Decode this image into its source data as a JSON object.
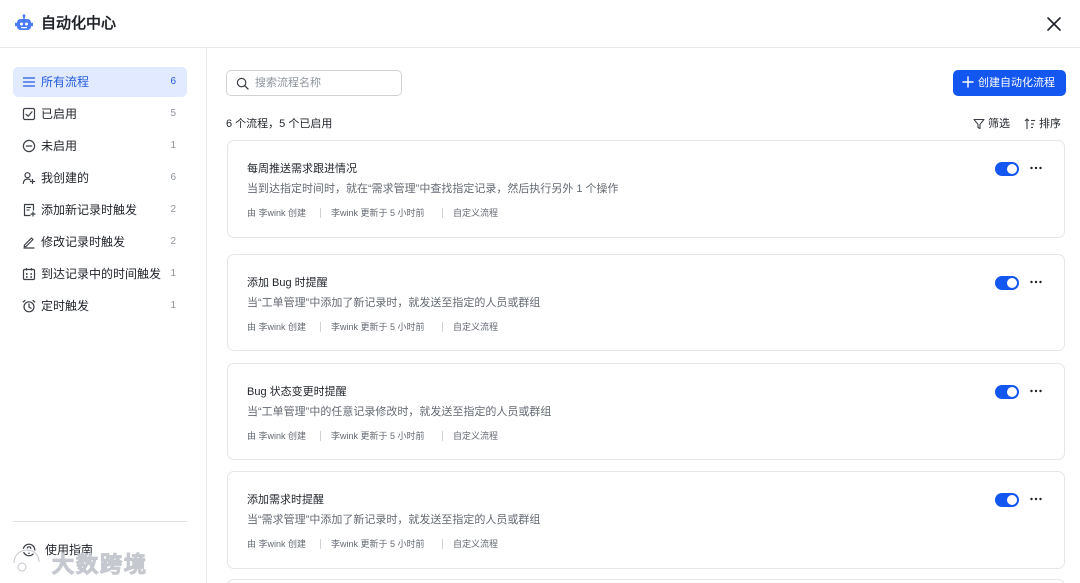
{
  "header": {
    "title": "自动化中心",
    "close_icon": "close-icon"
  },
  "sidebar": {
    "items": [
      {
        "label": "所有流程",
        "count": "6",
        "icon": "list-icon",
        "active": true
      },
      {
        "label": "已启用",
        "count": "5",
        "icon": "checkbox-icon"
      },
      {
        "label": "未启用",
        "count": "1",
        "icon": "minus-circle-icon"
      },
      {
        "label": "我创建的",
        "count": "6",
        "icon": "user-add-icon"
      },
      {
        "label": "添加新记录时触发",
        "count": "2",
        "icon": "add-record-icon"
      },
      {
        "label": "修改记录时触发",
        "count": "2",
        "icon": "edit-icon"
      },
      {
        "label": "到达记录中的时间触发",
        "count": "1",
        "icon": "calendar-icon"
      },
      {
        "label": "定时触发",
        "count": "1",
        "icon": "alarm-clock-icon"
      }
    ],
    "guide_label": "使用指南",
    "watermark": "大数跨境"
  },
  "search": {
    "placeholder": "搜索流程名称"
  },
  "create_button": "创建自动化流程",
  "summary": "6 个流程，5 个已启用",
  "filter_label": "筛选",
  "sort_label": "排序",
  "workflows": [
    {
      "title": "每周推送需求跟进情况",
      "description": "当到达指定时间时，就在“需求管理”中查找指定记录，然后执行另外 1 个操作",
      "creator": "由 李wink 创建",
      "updated": "李wink 更新于 5 小时前",
      "type": "自定义流程",
      "enabled": true
    },
    {
      "title": "添加 Bug 时提醒",
      "description": "当“工单管理”中添加了新记录时，就发送至指定的人员或群组",
      "creator": "由 李wink 创建",
      "updated": "李wink 更新于 5 小时前",
      "type": "自定义流程",
      "enabled": true
    },
    {
      "title": "Bug 状态变更时提醒",
      "description": "当“工单管理”中的任意记录修改时，就发送至指定的人员或群组",
      "creator": "由 李wink 创建",
      "updated": "李wink 更新于 5 小时前",
      "type": "自定义流程",
      "enabled": true
    },
    {
      "title": "添加需求时提醒",
      "description": "当“需求管理”中添加了新记录时，就发送至指定的人员或群组",
      "creator": "由 李wink 创建",
      "updated": "李wink 更新于 5 小时前",
      "type": "自定义流程",
      "enabled": true
    }
  ],
  "colors": {
    "accent": "#1456f0",
    "active_bg": "#e1eaff",
    "active_text": "#245bdb",
    "muted_text": "#646a73",
    "border": "#e4e6e9"
  }
}
